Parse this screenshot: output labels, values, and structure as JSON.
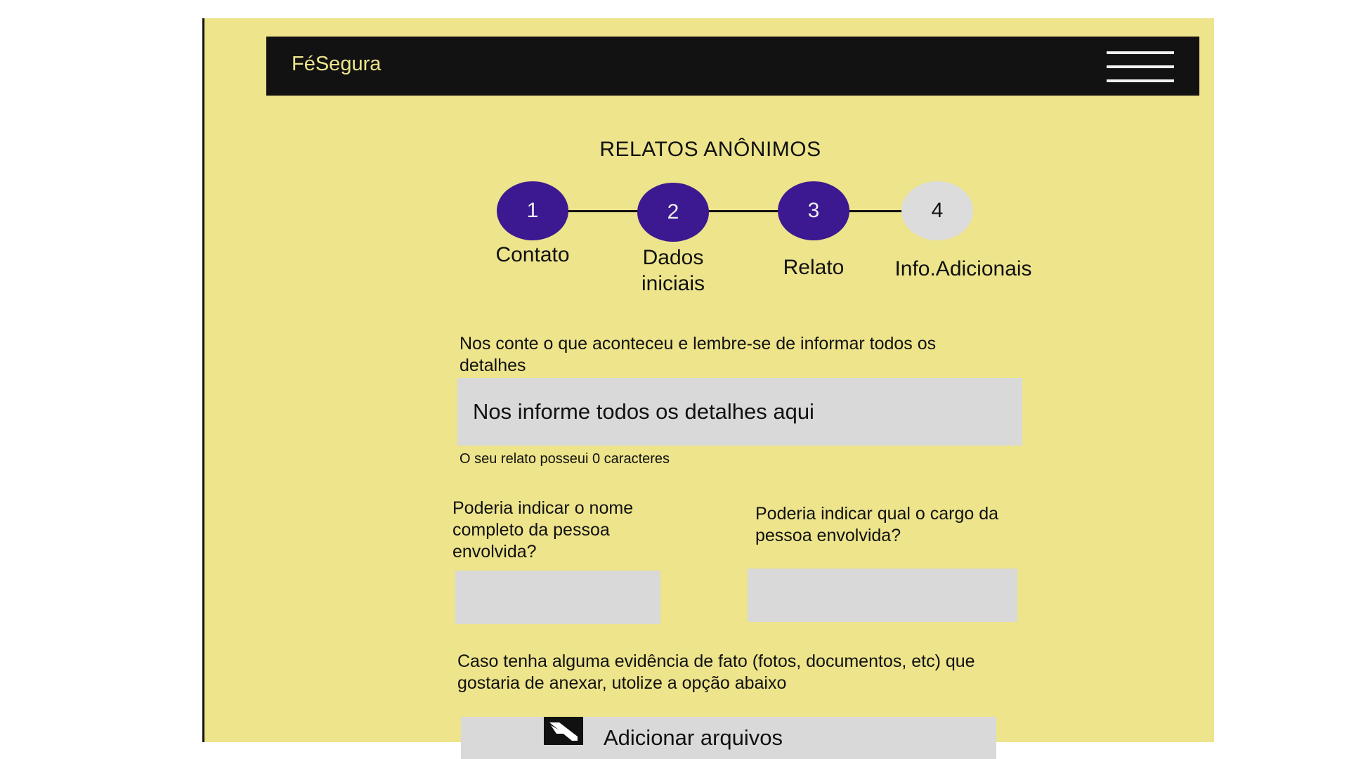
{
  "app": {
    "brand": "FéSegura"
  },
  "page": {
    "title": "RELATOS ANÔNIMOS"
  },
  "stepper": {
    "steps": [
      {
        "number": "1",
        "label_line1": "Contato",
        "label_line2": "",
        "state": "done"
      },
      {
        "number": "2",
        "label_line1": "Dados",
        "label_line2": "iniciais",
        "state": "done"
      },
      {
        "number": "3",
        "label_line1": "Relato",
        "label_line2": "",
        "state": "current"
      },
      {
        "number": "4",
        "label_line1": "Info.Adicionais",
        "label_line2": "",
        "state": "todo"
      }
    ]
  },
  "form": {
    "story_prompt": "Nos conte o que aconteceu e lembre-se de informar todos os detalhes",
    "story_placeholder": "Nos informe todos os detalhes aqui",
    "char_count_text": "O seu relato posseui 0 caracteres",
    "name_prompt": "Poderia indicar o nome completo da pessoa envolvida?",
    "name_value": "",
    "role_prompt": "Poderia indicar qual o cargo da pessoa envolvida?",
    "role_value": "",
    "evidence_prompt": "Caso tenha alguma evidência de fato (fotos, documentos, etc) que gostaria de anexar, utolize a opção abaixo",
    "upload_label": "Adicionar arquivos"
  },
  "colors": {
    "background": "#ede48b",
    "navbar": "#121212",
    "step_active": "#3c1891",
    "step_inactive": "#dcdcdc",
    "field": "#d9d9d9"
  },
  "icons": {
    "menu": "hamburger-menu-icon",
    "upload": "image-icon"
  }
}
